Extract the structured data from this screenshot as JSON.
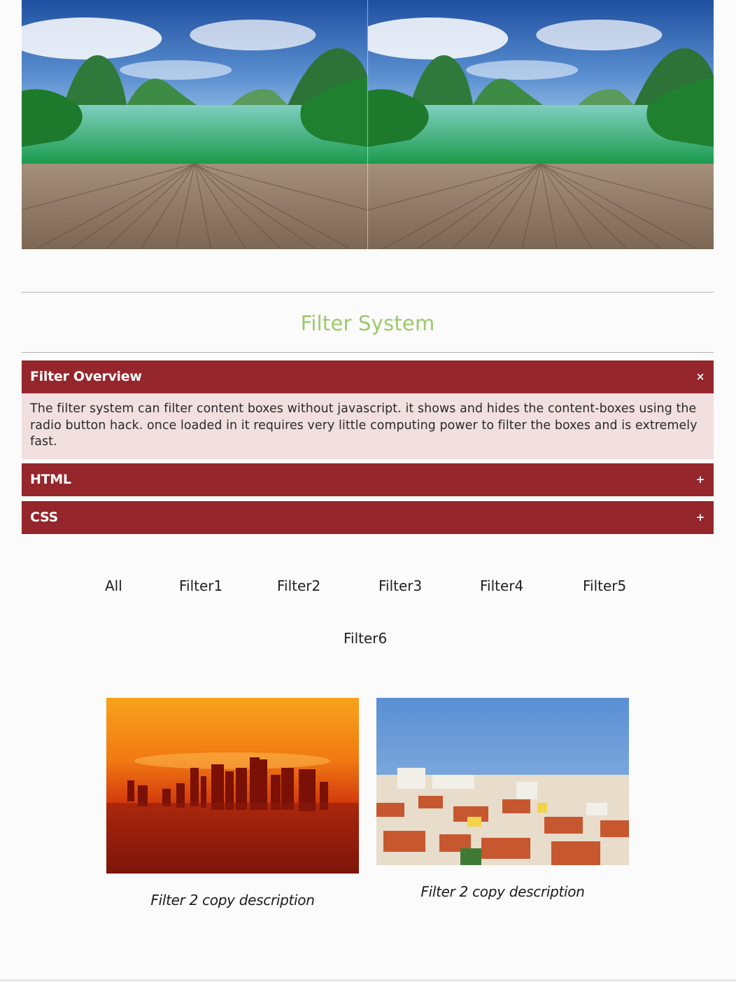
{
  "hero": {
    "images": [
      "karst-lake-dock-image",
      "karst-lake-dock-image"
    ]
  },
  "section": {
    "title": "Filter System",
    "title_color": "#9cc96b"
  },
  "accordion": {
    "accent_color": "#94262c",
    "panel_color": "#f2dfe0",
    "items": [
      {
        "label": "Filter Overview",
        "toggle": "×",
        "expanded": true,
        "body": "The filter system can filter content boxes without javascript. it shows and hides the content-boxes using the radio button hack. once loaded in it requires very little computing power to filter the boxes and is extremely fast."
      },
      {
        "label": "HTML",
        "toggle": "+",
        "expanded": false
      },
      {
        "label": "CSS",
        "toggle": "+",
        "expanded": false
      }
    ]
  },
  "filters": [
    "All",
    "Filter1",
    "Filter2",
    "Filter3",
    "Filter4",
    "Filter5",
    "Filter6"
  ],
  "cards": [
    {
      "image": "city-skyline-sunset-image",
      "caption": "Filter 2 copy description"
    },
    {
      "image": "coastal-town-rooftops-image",
      "caption": "Filter 2 copy description"
    }
  ]
}
